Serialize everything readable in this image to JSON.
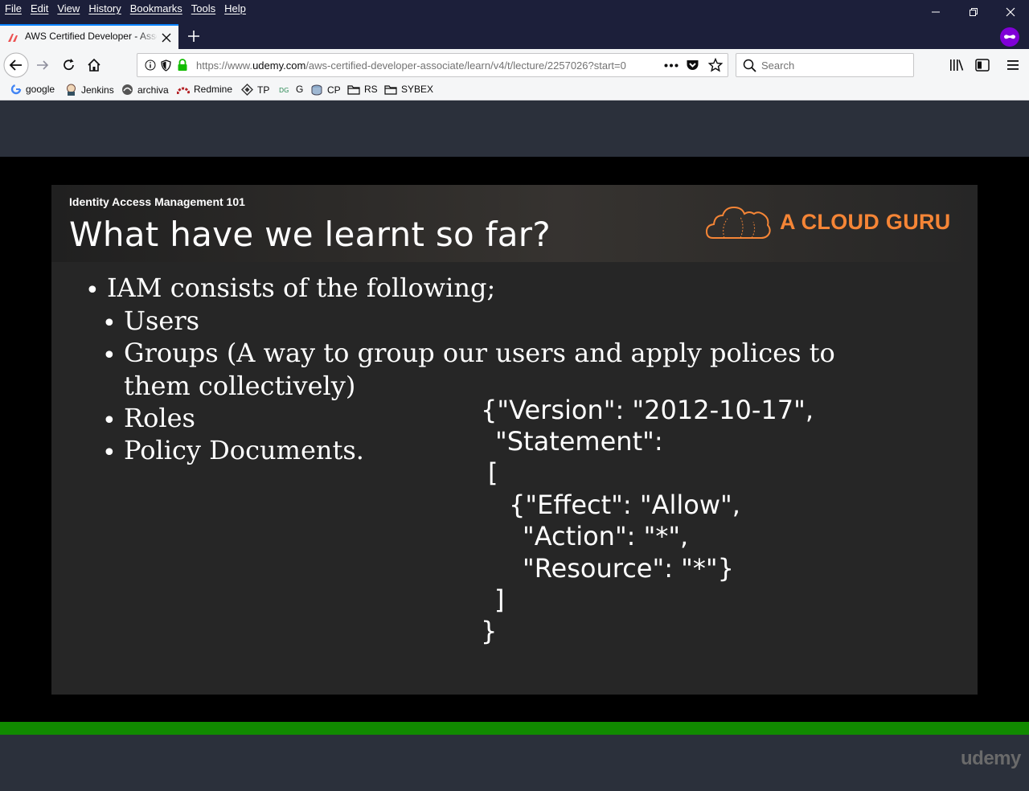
{
  "menubar": {
    "items": [
      "File",
      "Edit",
      "View",
      "History",
      "Bookmarks",
      "Tools",
      "Help"
    ]
  },
  "tab": {
    "title": "AWS Certified Developer - Associate",
    "close_icon": "close-icon",
    "new_tab_icon": "plus-icon"
  },
  "navbar": {
    "url_prefix": "https://www.",
    "url_domain": "udemy.com",
    "url_path": "/aws-certified-developer-associate/learn/v4/t/lecture/2257026?start=0",
    "search_placeholder": "Search"
  },
  "bookmarks": [
    {
      "label": "google",
      "icon": "google-icon"
    },
    {
      "label": "Jenkins",
      "icon": "jenkins-icon"
    },
    {
      "label": "archiva",
      "icon": "archiva-icon"
    },
    {
      "label": "Redmine",
      "icon": "redmine-icon"
    },
    {
      "label": "TP",
      "icon": "diamond-icon"
    },
    {
      "label": "G",
      "icon": "gitlab-icon"
    },
    {
      "label": "CP",
      "icon": "cp-icon"
    },
    {
      "label": "RS",
      "icon": "folder-icon"
    },
    {
      "label": "SYBEX",
      "icon": "folder-icon"
    }
  ],
  "slide": {
    "subtitle": "Identity Access Management 101",
    "heading": "What have we learnt so far?",
    "brand": "A CLOUD GURU",
    "bullet_main": "IAM consists of the following;",
    "sub_bullets": [
      "Users",
      "Groups (A way to group our users and apply polices to",
      "them collectively)",
      "Roles",
      "Policy Documents."
    ],
    "code_lines": [
      "{\"Version\": \"2012-10-17\",",
      "\"Statement\":",
      "[",
      "{\"Effect\": \"Allow\",",
      "\"Action\": \"*\",",
      "\"Resource\": \"*\"}",
      "]",
      "}"
    ]
  },
  "player": {
    "watermark": "udemy",
    "progress": 1.0,
    "accent_color": "#118a00"
  },
  "colors": {
    "brand_orange": "#f58536",
    "titlebar": "#1c1f3a",
    "page_bg": "#2b303b"
  }
}
